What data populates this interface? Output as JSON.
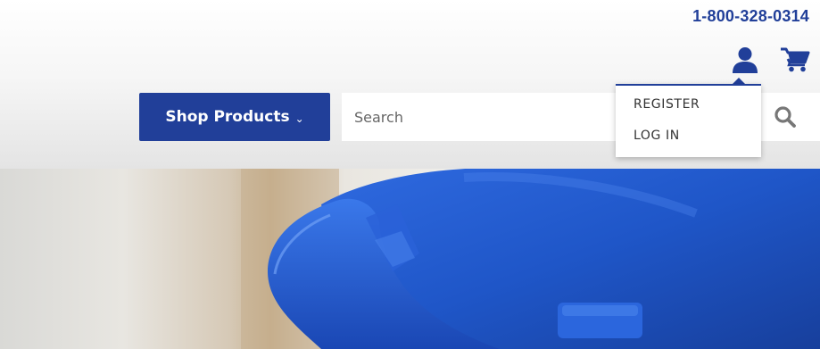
{
  "header": {
    "phone": "1-800-328-0314",
    "icons": {
      "account": "user-icon",
      "cart": "cart-icon",
      "search": "search-icon"
    },
    "shop_button": {
      "label": "Shop Products",
      "chevron": "⌄"
    },
    "search": {
      "placeholder": "Search",
      "value": ""
    },
    "account_menu": {
      "items": [
        {
          "label": "REGISTER"
        },
        {
          "label": "LOG IN"
        }
      ]
    }
  },
  "colors": {
    "brand_blue": "#213f99",
    "helmet_blue": "#1f56c8",
    "text_dark": "#333333"
  }
}
